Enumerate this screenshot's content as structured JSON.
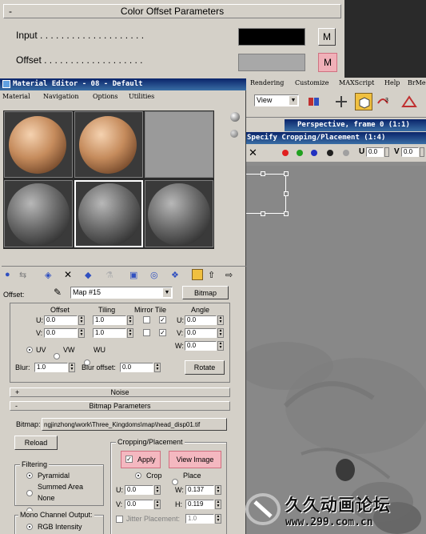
{
  "color_offset": {
    "title": "Color Offset Parameters",
    "input_label": "Input . . . . . . . . . . . . . . . . . . . .",
    "offset_label": "Offset . . . . . . . . . . . . . . . . . . .",
    "input_button": "M",
    "offset_button": "M",
    "input_color": "#000000",
    "offset_color": "#a8a8a8"
  },
  "main_menu": [
    "Rendering",
    "Customize",
    "MAXScript",
    "Help",
    "BrMe"
  ],
  "main_toolbar": {
    "view_select": "View"
  },
  "material_editor": {
    "title": "Material Editor - 08 - Default",
    "menu": [
      "Material",
      "Navigation",
      "Options",
      "Utilities"
    ],
    "map_name": "Map #15",
    "map_type": "Bitmap",
    "offset_label": "Offset:"
  },
  "coordinates": {
    "headers": {
      "offset": "Offset",
      "tiling": "Tiling",
      "mirror_tile": "Mirror Tile",
      "angle": "Angle"
    },
    "u_label": "U:",
    "v_label": "V:",
    "w_label": "W:",
    "u_offset": "0.0",
    "v_offset": "0.0",
    "u_tiling": "1.0",
    "v_tiling": "1.0",
    "u_angle": "0.0",
    "v_angle": "0.0",
    "w_angle": "0.0",
    "uv": "UV",
    "vw": "VW",
    "wu": "WU",
    "blur_label": "Blur:",
    "blur_value": "1.0",
    "blur_offset_label": "Blur offset:",
    "blur_offset_value": "0.0",
    "rotate": "Rotate"
  },
  "rollouts": {
    "noise": "Noise",
    "bitmap_params": "Bitmap Parameters",
    "noise_sign": "+",
    "bitmap_sign": "-"
  },
  "bitmap_params": {
    "bitmap_label": "Bitmap:",
    "bitmap_path": "ngjinzhong\\work\\Three_Kingdoms\\map\\head_disp01.tif",
    "reload": "Reload",
    "filtering_title": "Filtering",
    "filter_pyramidal": "Pyramidal",
    "filter_summed": "Summed Area",
    "filter_none": "None",
    "mono_title": "Mono Channel Output:",
    "mono_rgb": "RGB Intensity",
    "cropping_title": "Cropping/Placement",
    "apply": "Apply",
    "view_image": "View Image",
    "crop": "Crop",
    "place": "Place",
    "u_label": "U:",
    "v_label": "V:",
    "w_label": "W:",
    "h_label": "H:",
    "u_value": "0.0",
    "v_value": "0.0",
    "w_value": "0.137",
    "h_value": "0.119",
    "jitter_label": "Jitter Placement:",
    "jitter_value": "1.0",
    "highlight_color": "#e87878"
  },
  "perspective": {
    "title": "Perspective, frame 0 (1:1)"
  },
  "crop_window": {
    "title": "Specify Cropping/Placement (1:4)",
    "u_label": "U",
    "u_value": "0.0",
    "v_label": "V",
    "v_value": "0.0"
  },
  "watermark": {
    "chinese": "久久动画论坛",
    "site": "www.299.com.cn",
    "site_short": "299"
  }
}
